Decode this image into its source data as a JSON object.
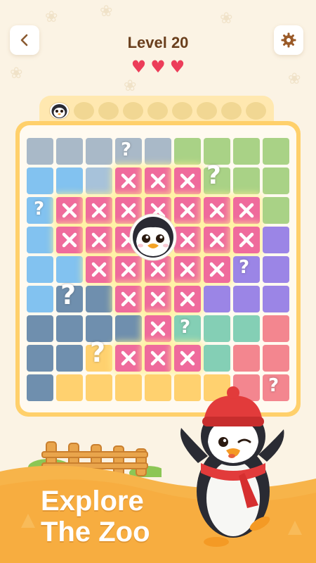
{
  "header": {
    "title": "Level 20",
    "lives": 3,
    "back_icon": "chevron-left-icon",
    "settings_icon": "gear-icon"
  },
  "collection": {
    "slots_total": 9,
    "slots_filled": 1
  },
  "board": {
    "rows": 9,
    "cols": 9,
    "colors": {
      "G": "#a9b9c8",
      "L": "#a9d286",
      "B": "#82c2f0",
      "F": "#a7c2da",
      "P": "#9b85e6",
      "S": "#6f8fae",
      "T": "#84cfb5",
      "R": "#f3868f",
      "Y": "#ffd16f",
      "X": "#ef6b9c"
    },
    "grid": [
      [
        "G",
        "G",
        "G",
        "G",
        "G",
        "L",
        "L",
        "L",
        "L"
      ],
      [
        "B",
        "B",
        "F",
        "X",
        "X",
        "X",
        "L",
        "L",
        "L"
      ],
      [
        "B",
        "X",
        "X",
        "X",
        "X",
        "X",
        "X",
        "X",
        "L"
      ],
      [
        "B",
        "X",
        "X",
        "X",
        "X",
        "X",
        "X",
        "X",
        "P"
      ],
      [
        "B",
        "B",
        "X",
        "X",
        "X",
        "X",
        "X",
        "P",
        "P"
      ],
      [
        "B",
        "S",
        "S",
        "X",
        "X",
        "X",
        "P",
        "P",
        "P"
      ],
      [
        "S",
        "S",
        "S",
        "S",
        "X",
        "T",
        "T",
        "T",
        "R"
      ],
      [
        "S",
        "S",
        "Y",
        "X",
        "X",
        "X",
        "T",
        "R",
        "R"
      ],
      [
        "S",
        "Y",
        "Y",
        "Y",
        "Y",
        "Y",
        "Y",
        "R",
        "R"
      ]
    ],
    "question_marks": "?"
  },
  "promo": {
    "line1": "Explore",
    "line2": "The Zoo"
  }
}
